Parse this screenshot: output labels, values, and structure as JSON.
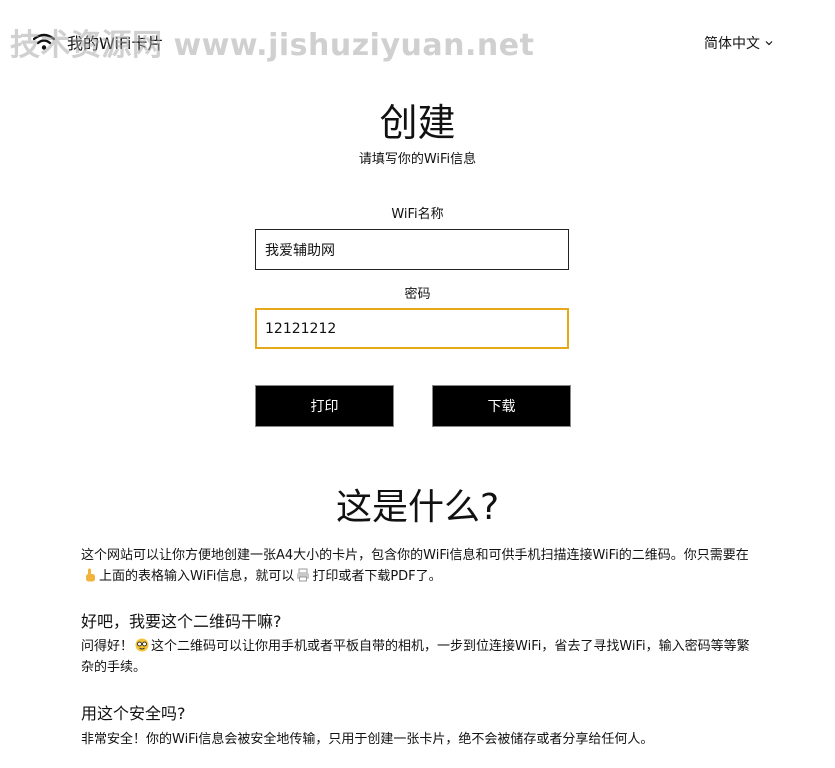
{
  "header": {
    "brand_name": "我的WiFi卡片",
    "watermark": "技术资源网 www.jishuziyuan.net",
    "language": "简体中文"
  },
  "form": {
    "title": "创建",
    "subtitle": "请填写你的WiFi信息",
    "ssid_label": "WiFi名称",
    "ssid_value": "我爱辅助网",
    "password_label": "密码",
    "password_value": "12121212",
    "print_label": "打印",
    "download_label": "下载"
  },
  "faq": {
    "title": "这是什么?",
    "intro_a": "这个网站可以让你方便地创建一张A4大小的卡片，包含你的WiFi信息和可供手机扫描连接WiFi的二维码。你只需要在",
    "intro_b": "上面的表格输入WiFi信息，就可以",
    "intro_c": "打印或者下载PDF了。",
    "q1": "好吧，我要这个二维码干嘛?",
    "a1_a": "问得好！",
    "a1_b": "这个二维码可以让你用手机或者平板自带的相机，一步到位连接WiFi，省去了寻找WiFi，输入密码等等繁杂的手续。",
    "q2": "用这个安全吗?",
    "a2": "非常安全！你的WiFi信息会被安全地传输，只用于创建一张卡片，绝不会被储存或者分享给任何人。"
  },
  "icons": {
    "wifi": "wifi-icon",
    "language_chevron": "chevron-down-icon",
    "pointing_hand": "pointing-hand-icon",
    "printer": "printer-icon",
    "nerd_face": "nerd-face-icon"
  },
  "colors": {
    "accent_focus": "#e6a817",
    "button_bg": "#000000",
    "button_text": "#ffffff"
  }
}
